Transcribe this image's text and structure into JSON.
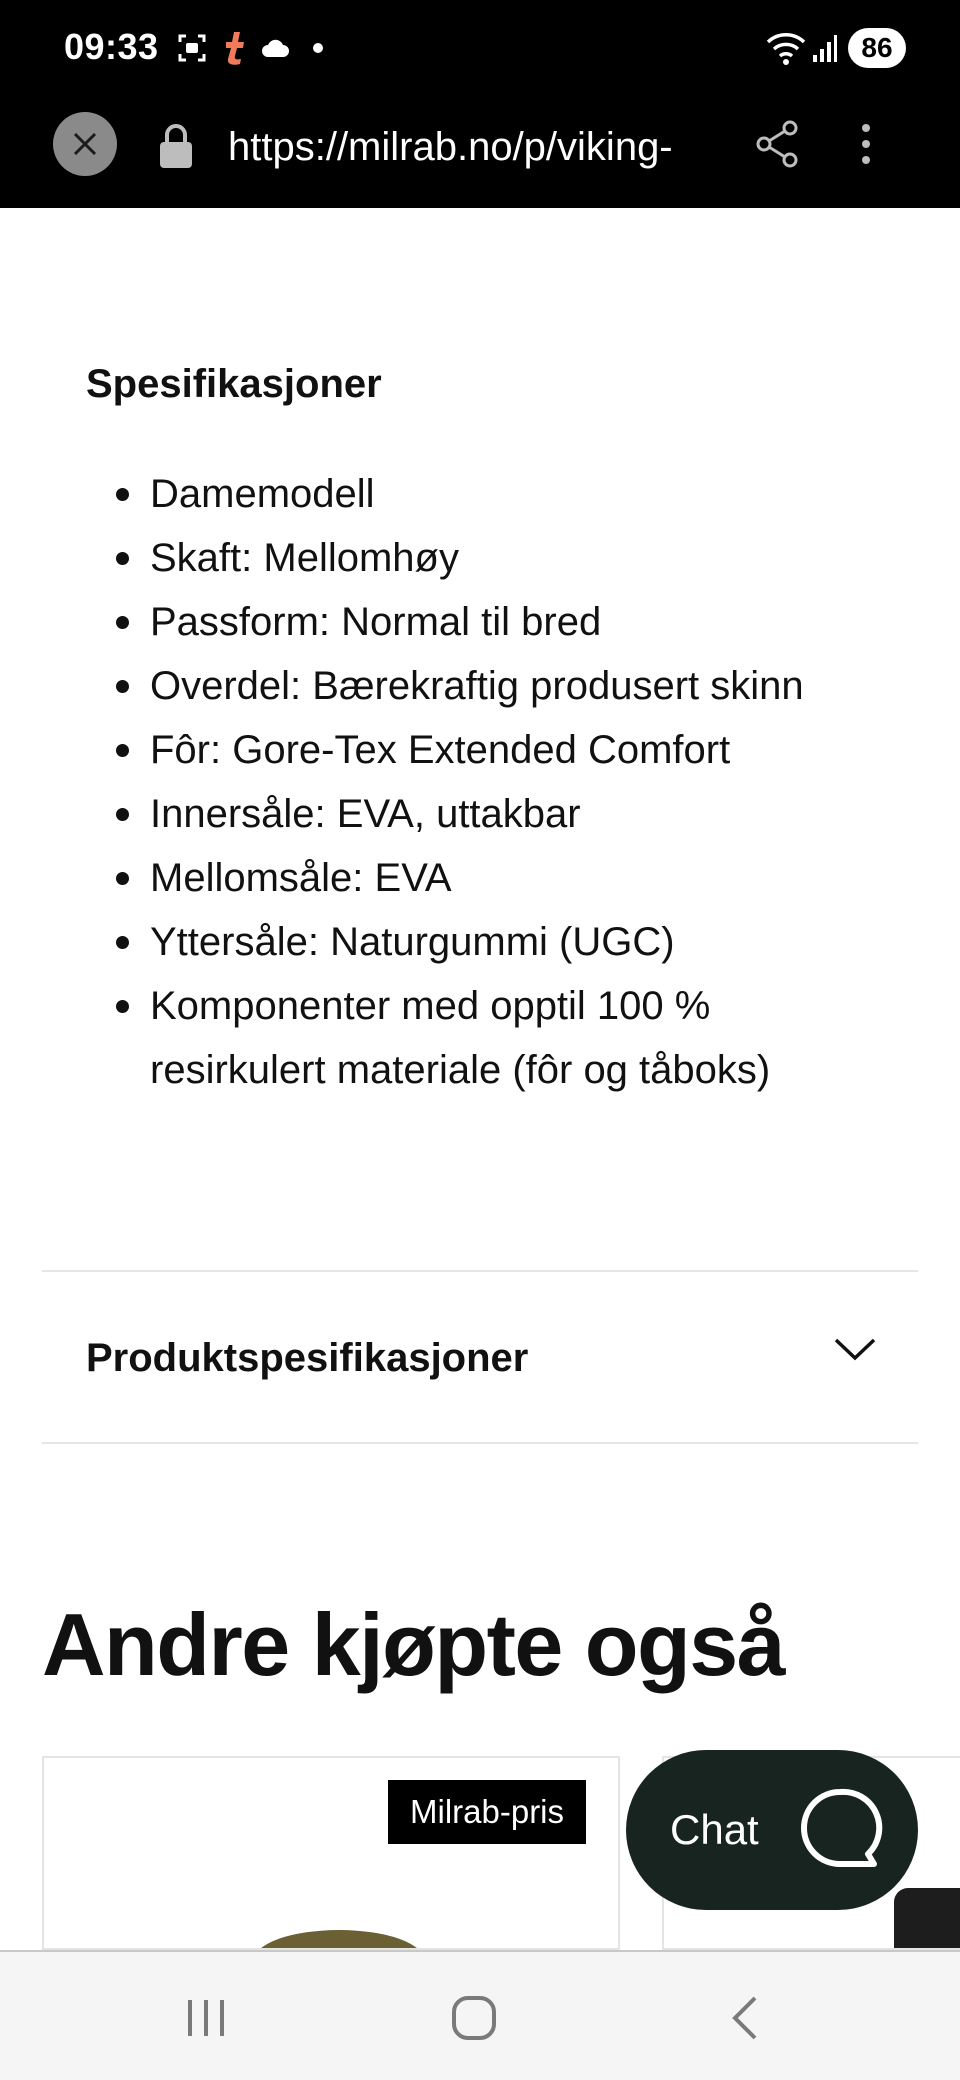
{
  "status_bar": {
    "time": "09:33",
    "battery": "86",
    "icons": [
      "screenshot-icon",
      "tumblr-icon",
      "cloud-icon",
      "dot-icon",
      "wifi-icon",
      "signal-icon",
      "battery-icon"
    ]
  },
  "browser": {
    "url": "https://milrab.no/p/viking-",
    "icons": [
      "close-icon",
      "lock-icon",
      "share-icon",
      "more-vert-icon"
    ]
  },
  "specs": {
    "heading": "Spesifikasjoner",
    "items": [
      "Damemodell",
      "Skaft: Mellomhøy",
      "Passform: Normal til bred",
      "Overdel: Bærekraftig produsert skinn",
      "Fôr: Gore-Tex Extended Comfort",
      "Innersåle: EVA, uttakbar",
      "Mellomsåle: EVA",
      "Yttersåle: Naturgummi (UGC)",
      "Komponenter med opptil 100 % resirkulert materiale (fôr og tåboks)"
    ]
  },
  "accordion": {
    "label": "Produktspesifikasjoner"
  },
  "related": {
    "title": "Andre kjøpte også",
    "badge": "Milrab-pris"
  },
  "chat": {
    "label": "Chat"
  },
  "colors": {
    "chat_bg": "#17241f",
    "status_bar_bg": "#000000",
    "tumblr_accent": "#f07a5a"
  }
}
